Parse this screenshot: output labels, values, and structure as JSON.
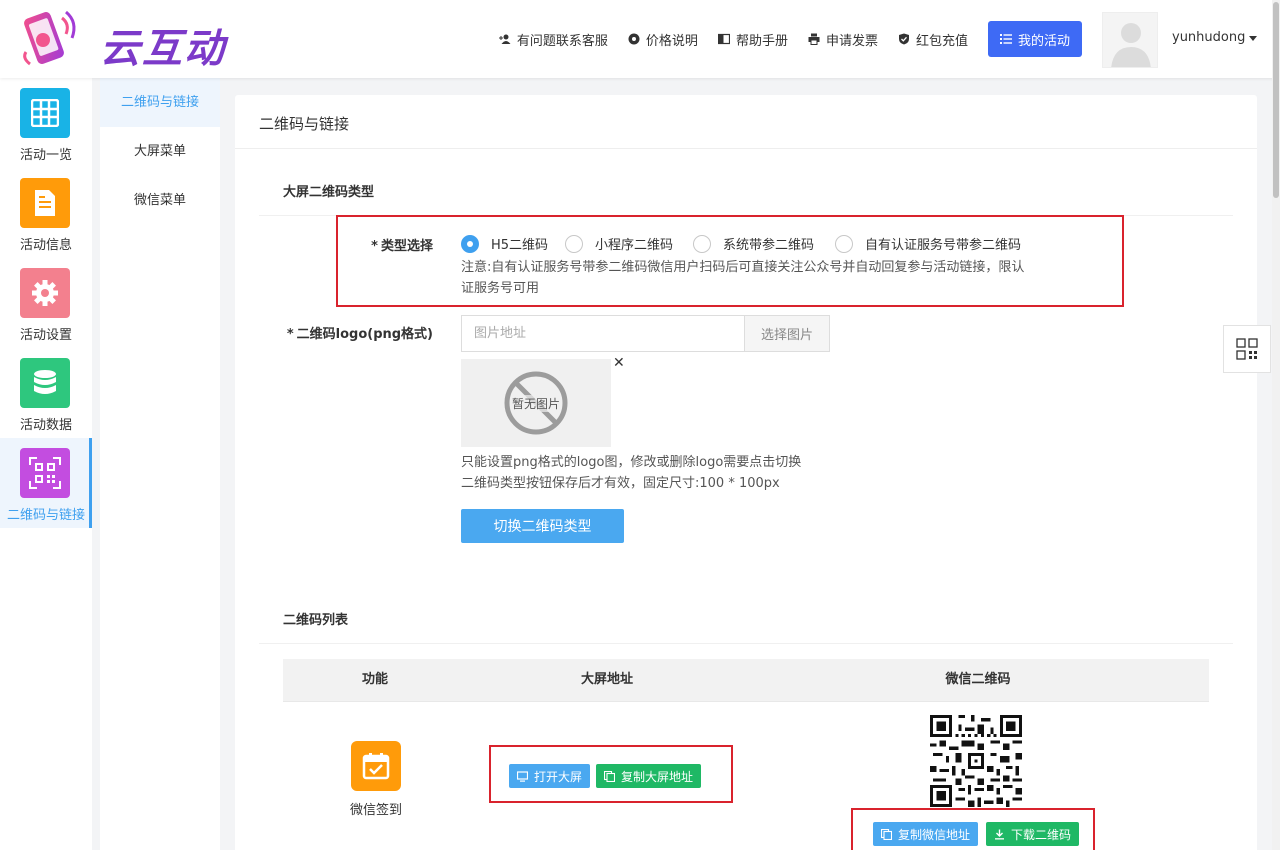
{
  "app": {
    "brand": "云互动"
  },
  "header": {
    "nav": [
      {
        "label": "有问题联系客服",
        "icon": "user-add-icon"
      },
      {
        "label": "价格说明",
        "icon": "gear-badge-icon"
      },
      {
        "label": "帮助手册",
        "icon": "book-icon"
      },
      {
        "label": "申请发票",
        "icon": "printer-icon"
      },
      {
        "label": "红包充值",
        "icon": "shield-check-icon"
      }
    ],
    "primary_button": "我的活动",
    "username": "yunhudong"
  },
  "sidebar": {
    "items": [
      {
        "label": "活动一览",
        "color": "#19b3e6",
        "icon": "grid-icon"
      },
      {
        "label": "活动信息",
        "color": "#ff9b0a",
        "icon": "document-icon"
      },
      {
        "label": "活动设置",
        "color": "#f3808e",
        "icon": "gear-icon"
      },
      {
        "label": "活动数据",
        "color": "#2ec77e",
        "icon": "database-icon"
      },
      {
        "label": "二维码与链接",
        "color": "#c34de0",
        "icon": "qrcode-icon",
        "active": true
      }
    ]
  },
  "submenu": {
    "items": [
      {
        "label": "二维码与链接",
        "active": true
      },
      {
        "label": "大屏菜单"
      },
      {
        "label": "微信菜单"
      }
    ]
  },
  "main": {
    "title": "二维码与链接",
    "qr_type_section": {
      "title": "大屏二维码类型",
      "type_label": "类型选择",
      "options": [
        "H5二维码",
        "小程序二维码",
        "系统带参二维码",
        "自有认证服务号带参二维码"
      ],
      "selected": "H5二维码",
      "note_line1": "注意:自有认证服务号带参二维码微信用户扫码后可直接关注公众号并自动回复参与活动链接，限认",
      "note_line2": "证服务号可用"
    },
    "logo_field": {
      "label": "二维码logo(png格式)",
      "placeholder": "图片地址",
      "select_button": "选择图片",
      "no_image_text": "暂无图片",
      "hint_line1": "只能设置png格式的logo图，修改或删除logo需要点击切换",
      "hint_line2": "二维码类型按钮保存后才有效，固定尺寸:100 * 100px",
      "switch_button": "切换二维码类型"
    },
    "qr_list": {
      "title": "二维码列表",
      "columns": [
        "功能",
        "大屏地址",
        "微信二维码"
      ],
      "rows": [
        {
          "function": "微信签到",
          "open_screen": "打开大屏",
          "copy_screen": "复制大屏地址",
          "copy_wechat": "复制微信地址",
          "download_qr": "下载二维码"
        }
      ]
    }
  },
  "colors": {
    "accent": "#3fa0ef",
    "primary_button": "#3e6af5",
    "green": "#1fb865",
    "highlight_box": "#d9232d"
  }
}
